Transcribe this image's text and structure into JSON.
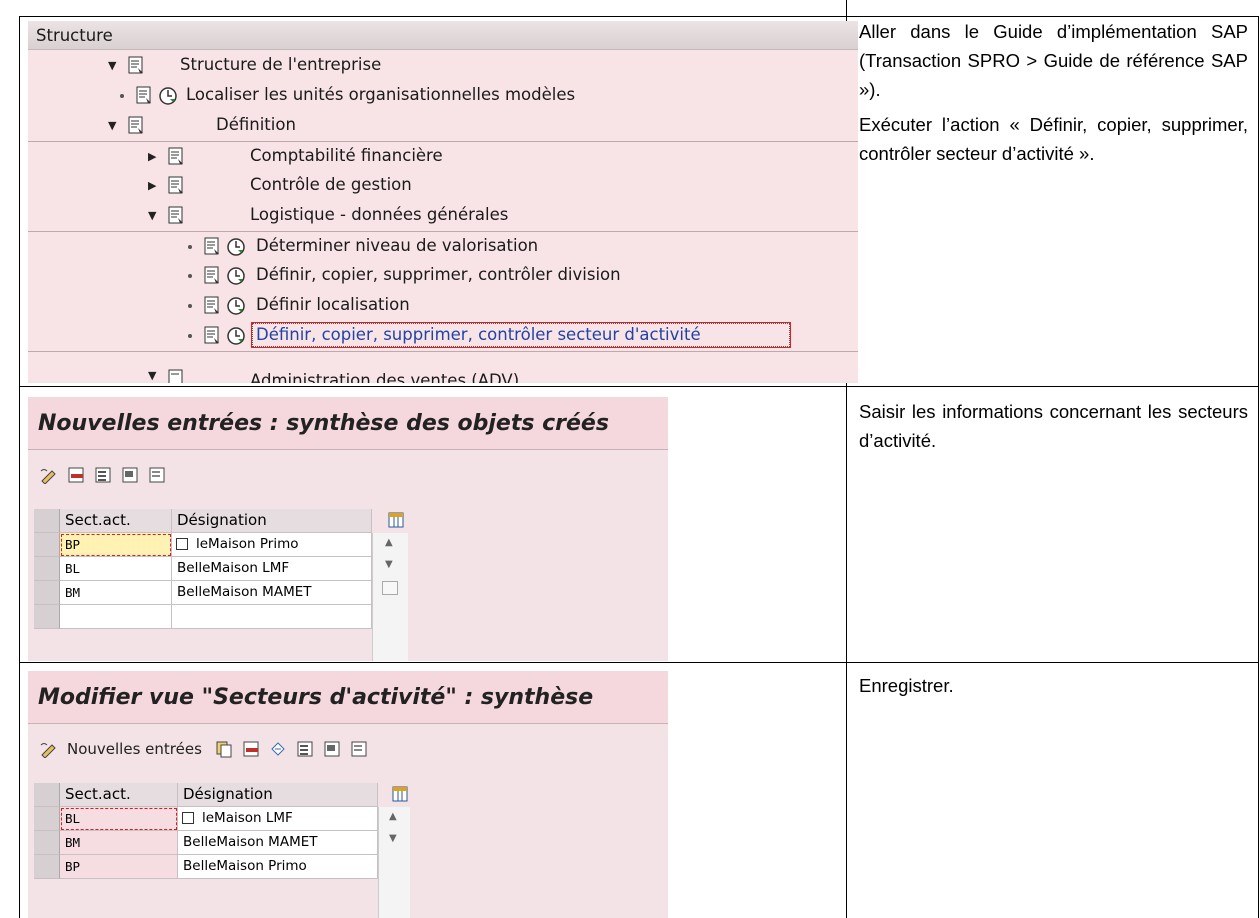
{
  "tree": {
    "header": "Structure",
    "rows": [
      {
        "label": "Structure de l'entreprise"
      },
      {
        "label": "Localiser les unités organisationnelles modèles"
      },
      {
        "label": "Définition"
      },
      {
        "label": "Comptabilité financière"
      },
      {
        "label": "Contrôle de gestion"
      },
      {
        "label": "Logistique - données générales"
      },
      {
        "label": "Déterminer niveau de valorisation"
      },
      {
        "label": "Définir, copier, supprimer, contrôler division"
      },
      {
        "label": "Définir localisation"
      },
      {
        "label": "Définir, copier, supprimer, contrôler secteur d'activité"
      },
      {
        "label": "Administration des ventes (ADV)"
      }
    ]
  },
  "instructions": {
    "step1_p1": "Aller dans le Guide d’implémentation SAP (Transaction SPRO > Guide de référence SAP »).",
    "step1_p2": "Exécuter l’action « Définir, copier, supprimer, contrôler secteur d’activité ».",
    "step2": "Saisir les informations concernant les secteurs d’activité.",
    "step3": "Enregistrer."
  },
  "screen_new": {
    "title": "Nouvelles entrées : synthèse des objets créés",
    "columns": [
      "Sect.act.",
      "Désignation"
    ],
    "rows": [
      {
        "key": "BP",
        "name": "leMaison Primo"
      },
      {
        "key": "BL",
        "name": "BelleMaison LMF"
      },
      {
        "key": "BM",
        "name": "BelleMaison MAMET"
      }
    ]
  },
  "screen_modify": {
    "title": "Modifier vue \"Secteurs d'activité\" : synthèse",
    "toolbar_label": "Nouvelles entrées",
    "columns": [
      "Sect.act.",
      "Désignation"
    ],
    "rows": [
      {
        "key": "BL",
        "name": "leMaison LMF"
      },
      {
        "key": "BM",
        "name": "BelleMaison MAMET"
      },
      {
        "key": "BP",
        "name": "BelleMaison Primo"
      }
    ]
  },
  "colors": {
    "sap_background": "#f3e3e6",
    "link_blue": "#1f43a6",
    "focus_red": "#e02020"
  }
}
